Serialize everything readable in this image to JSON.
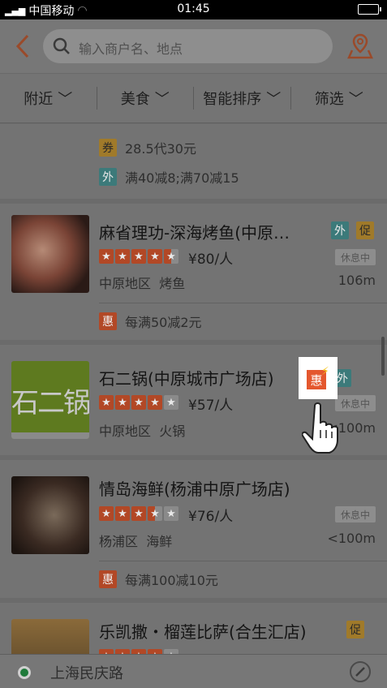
{
  "status_bar": {
    "carrier": "中国移动",
    "time": "01:45"
  },
  "header": {
    "search_placeholder": "输入商户名、地点"
  },
  "filters": [
    "附近",
    "美食",
    "智能排序",
    "筛选"
  ],
  "partial_card": {
    "promos": [
      {
        "badge": "券",
        "text": "28.5代30元"
      },
      {
        "badge": "外",
        "text": "满40减8;满70减15"
      }
    ]
  },
  "restaurants": [
    {
      "name": "麻省理功-深海烤鱼(中原…",
      "badges": [
        "外",
        "促"
      ],
      "price": "¥80/人",
      "status": "休息中",
      "area": "中原地区",
      "category": "烤鱼",
      "distance": "106m",
      "rating": 4.5,
      "promo": {
        "badge": "惠",
        "text": "每满50减2元"
      }
    },
    {
      "name": "石二锅(中原城市广场店)",
      "badges": [
        "惠",
        "外"
      ],
      "price": "¥57/人",
      "status": "休息中",
      "area": "中原地区",
      "category": "火锅",
      "distance": "<100m",
      "rating": 4,
      "thumb_text": "石二锅"
    },
    {
      "name": "情岛海鲜(杨浦中原广场店)",
      "badges": [],
      "price": "¥76/人",
      "status": "休息中",
      "area": "杨浦区",
      "category": "海鲜",
      "distance": "<100m",
      "rating": 3.5,
      "promo": {
        "badge": "惠",
        "text": "每满100减10元"
      }
    },
    {
      "name": "乐凯撒・榴莲比萨(合生汇店)",
      "badges": [
        "促"
      ],
      "rating": 4
    }
  ],
  "bottom_bar": {
    "location": "上海民庆路"
  },
  "colors": {
    "accent": "#e4572e",
    "teal": "#2fa3a3",
    "gold": "#e0a100"
  }
}
